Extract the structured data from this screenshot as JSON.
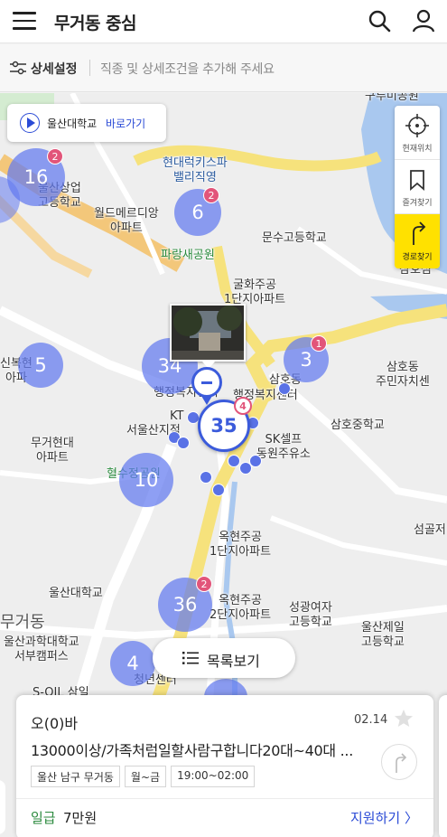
{
  "header": {
    "title": "무거동 중심"
  },
  "filter": {
    "label": "상세설정",
    "hint": "직종 및 상세조건을 추가해 주세요"
  },
  "map": {
    "shortcut": {
      "place": "울산대학교",
      "action": "바로가기"
    },
    "side_buttons": [
      {
        "label": "현재위치",
        "icon": "crosshair-icon"
      },
      {
        "label": "즐겨찾기",
        "icon": "bookmark-icon"
      },
      {
        "label": "경로찾기",
        "icon": "route-arrow-icon"
      }
    ],
    "labels": {
      "gubo": "구루미공원",
      "hyundai_rec": "현대럭키스파\n밸리직영",
      "ulsan_hs": "울산상업\n고등학교",
      "world_apt": "월드메르디앙\n아파트",
      "parang_park": "파랑새공원",
      "munsu_hs": "문수고등학교",
      "samho_island": "삼호섬",
      "gulhwa_apt": "굴화주공\n1단지아파트",
      "samho_center": "삼호동\n주민자치센",
      "sinbok": "신복현\n아파",
      "haengjeong": "행정복지센터",
      "samhodong": "삼호동",
      "haengjeong2": "행정복지센터",
      "samho_ms": "삼호중학교",
      "kt": "KT",
      "seoulsan": "서울산지점",
      "sk": "SK셀프\n동원주유소",
      "mugeo_apt": "무거현대\n아파트",
      "hyeolsu": "혈수정공원",
      "okhyeon1": "옥현주공\n1단지아파트",
      "seomgol": "섬골저",
      "ulsan_univ": "울산대학교",
      "okhyeon2": "옥현주공\n2단지아파트",
      "seongmo": "성광여자\n고등학교",
      "ulsan_jeil": "울산제일\n고등학교",
      "mugeo_area": "무거동",
      "science": "울산과학대학교\n서부캠퍼스",
      "youth": "청년센터",
      "soil": "S-OIL 삼일"
    },
    "clusters": [
      {
        "count": "16",
        "badge": "2"
      },
      {
        "count": "6",
        "badge": "2"
      },
      {
        "count": "5"
      },
      {
        "count": "34"
      },
      {
        "count": "3",
        "badge": "1"
      },
      {
        "count": "10"
      },
      {
        "count": "36",
        "badge": "2"
      },
      {
        "count": "4"
      }
    ],
    "selected_cluster": "35",
    "red_marker": "4"
  },
  "list_button": {
    "label": "목록보기"
  },
  "job_card": {
    "company": "오(0)바",
    "date": "02.14",
    "title": "13000이상/가족처럼일할사람구합니다20대~40대 ...",
    "tags": [
      "울산 남구 무거동",
      "월~금",
      "19:00~02:00"
    ],
    "pay_type": "일급",
    "pay_amount": "7만원",
    "apply": "지원하기 〉"
  }
}
